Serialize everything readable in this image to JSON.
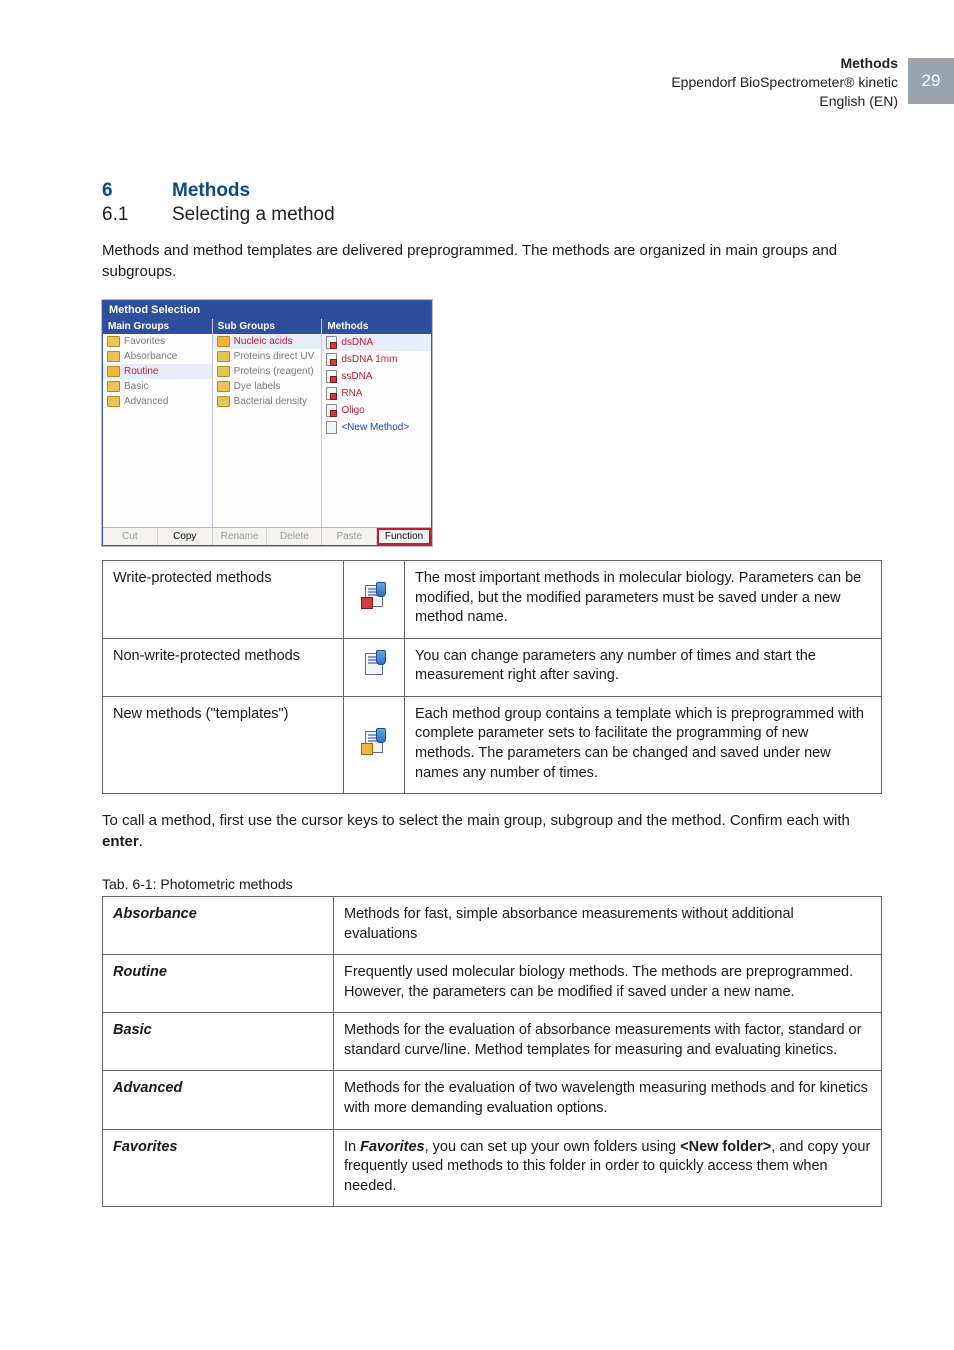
{
  "header": {
    "title": "Methods",
    "device_line": "Eppendorf BioSpectrometer® kinetic",
    "lang_line": "English (EN)",
    "page_number": "29"
  },
  "headings": {
    "section_num": "6",
    "section_title": "Methods",
    "subsection_num": "6.1",
    "subsection_title": "Selecting a method"
  },
  "lead": "Methods and method templates are delivered preprogrammed. The methods are organized in main groups and subgroups.",
  "screenshot": {
    "window_title": "Method Selection",
    "headers": {
      "main": "Main Groups",
      "sub": "Sub Groups",
      "methods": "Methods"
    },
    "main_groups": [
      {
        "label": "Favorites",
        "selected": false
      },
      {
        "label": "Absorbance",
        "selected": false
      },
      {
        "label": "Routine",
        "selected": true
      },
      {
        "label": "Basic",
        "selected": false
      },
      {
        "label": "Advanced",
        "selected": false
      }
    ],
    "sub_groups": [
      {
        "label": "Nucleic acids",
        "selected": true
      },
      {
        "label": "Proteins direct UV",
        "selected": false
      },
      {
        "label": "Proteins (reagent)",
        "selected": false
      },
      {
        "label": "Dye labels",
        "selected": false
      },
      {
        "label": "Bacterial density",
        "selected": false
      }
    ],
    "methods": [
      {
        "label": "dsDNA",
        "locked": true,
        "selected": true
      },
      {
        "label": "dsDNA 1mm",
        "locked": true,
        "selected": false
      },
      {
        "label": "ssDNA",
        "locked": true,
        "selected": false
      },
      {
        "label": "RNA",
        "locked": true,
        "selected": false
      },
      {
        "label": "Oligo",
        "locked": true,
        "selected": false
      },
      {
        "label": "<New Method>",
        "locked": false,
        "selected": false,
        "blue": true
      }
    ],
    "buttons": [
      {
        "label": "Cut",
        "active": false
      },
      {
        "label": "Copy",
        "active": true
      },
      {
        "label": "Rename",
        "active": false
      },
      {
        "label": "Delete",
        "active": false
      },
      {
        "label": "Paste",
        "active": false
      },
      {
        "label": "Function",
        "active": true,
        "highlighted": true
      }
    ]
  },
  "method_types": [
    {
      "name": "Write-protected methods",
      "kind": "locked",
      "desc": "The most important methods in molecular biology. Parameters can be modified, but the modified parameters must be saved under a new method name."
    },
    {
      "name": "Non-write-protected methods",
      "kind": "normal",
      "desc": "You can change parameters any number of times and start the measurement right after saving."
    },
    {
      "name": "New methods (\"templates\")",
      "kind": "template",
      "desc": "Each method group contains a template which is preprogrammed with complete parameter sets to facilitate the programming of new methods. The parameters can be changed and saved under new names any number of times."
    }
  ],
  "after_note_pre": "To call a method, first use the cursor keys to select the main group, subgroup and the method. Confirm each with ",
  "after_note_strong": "enter",
  "after_note_post": ".",
  "table_caption": "Tab. 6-1:   Photometric methods",
  "categories": [
    {
      "name": "Absorbance",
      "desc": "Methods for fast, simple absorbance measurements without additional evaluations"
    },
    {
      "name": "Routine",
      "desc": "Frequently used molecular biology methods. The methods are preprogrammed. However, the parameters can be modified if saved under a new name."
    },
    {
      "name": "Basic",
      "desc": "Methods for the evaluation of absorbance measurements with factor, standard or standard curve/line. Method templates for measuring and evaluating kinetics."
    },
    {
      "name": "Advanced",
      "desc": "Methods for the evaluation of two wavelength measuring methods and for kinetics with more demanding evaluation options."
    },
    {
      "name": "Favorites",
      "desc_parts": {
        "pre": "In ",
        "fav": "Favorites",
        "mid": ", you can set up your own folders using ",
        "nf": "<New folder>",
        "post": ", and copy your frequently used methods to this folder in order to quickly access them when needed."
      }
    }
  ]
}
